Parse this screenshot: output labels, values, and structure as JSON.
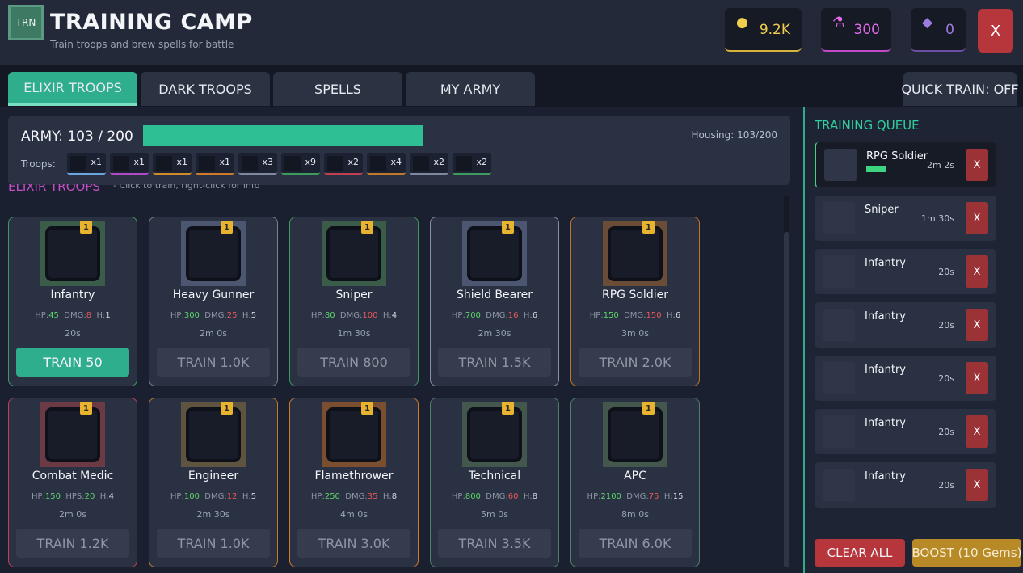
{
  "header": {
    "logo_text": "TRN",
    "title": "TRAINING CAMP",
    "subtitle": "Train troops and brew spells for battle",
    "resources": {
      "gold": "9.2K",
      "elixir": "300",
      "dark_elixir": "0"
    },
    "close_label": "X"
  },
  "tabs": [
    "ELIXIR TROOPS",
    "DARK TROOPS",
    "SPELLS",
    "MY ARMY"
  ],
  "active_tab": "ELIXIR TROOPS",
  "quick_train": "QUICK TRAIN: OFF",
  "army": {
    "label": "ARMY: 103 / 200",
    "fill_fraction": 0.515,
    "housing": "Housing: 103/200",
    "troops_label": "Troops:",
    "chips": [
      {
        "count": "x1",
        "color": "#6aa6e0"
      },
      {
        "count": "x1",
        "color": "#b04ac9"
      },
      {
        "count": "x1",
        "color": "#d08a2a"
      },
      {
        "count": "x1",
        "color": "#d07a2a"
      },
      {
        "count": "x3",
        "color": "#8088a0"
      },
      {
        "count": "x9",
        "color": "#3f9a60"
      },
      {
        "count": "x2",
        "color": "#c04050"
      },
      {
        "count": "x4",
        "color": "#c07a2a"
      },
      {
        "count": "x2",
        "color": "#8088a0"
      },
      {
        "count": "x2",
        "color": "#3f9a60"
      }
    ]
  },
  "section": {
    "title": "ELIXIR TROOPS",
    "hint": "- Click to train, right-click for info"
  },
  "cards": [
    {
      "name": "Infantry",
      "level": "1",
      "s1": "HP:",
      "v1": "45",
      "s2": "DMG:",
      "v2": "8",
      "s3": "H:",
      "v3": "1",
      "time": "20s",
      "train": "TRAIN  50",
      "border": "#3e9a5c",
      "portrait": "#3b5c48"
    },
    {
      "name": "Heavy Gunner",
      "level": "1",
      "s1": "HP:",
      "v1": "300",
      "s2": "DMG:",
      "v2": "25",
      "s3": "H:",
      "v3": "5",
      "time": "2m 0s",
      "train": "TRAIN  1.0K",
      "border": "#7a8090",
      "portrait": "#4d5670"
    },
    {
      "name": "Sniper",
      "level": "1",
      "s1": "HP:",
      "v1": "80",
      "s2": "DMG:",
      "v2": "100",
      "s3": "H:",
      "v3": "4",
      "time": "1m 30s",
      "train": "TRAIN  800",
      "border": "#3e9a5c",
      "portrait": "#3b5c48"
    },
    {
      "name": "Shield Bearer",
      "level": "1",
      "s1": "HP:",
      "v1": "700",
      "s2": "DMG:",
      "v2": "16",
      "s3": "H:",
      "v3": "6",
      "time": "2m 30s",
      "train": "TRAIN  1.5K",
      "border": "#8a90a8",
      "portrait": "#4d5670"
    },
    {
      "name": "RPG Soldier",
      "level": "1",
      "s1": "HP:",
      "v1": "150",
      "s2": "DMG:",
      "v2": "150",
      "s3": "H:",
      "v3": "6",
      "time": "3m 0s",
      "train": "TRAIN  2.0K",
      "border": "#c0742a",
      "portrait": "#6b4c36"
    },
    {
      "name": "Combat Medic",
      "level": "1",
      "s1": "HP:",
      "v1": "150",
      "s2": "HPS:",
      "v2": "20",
      "s3": "H:",
      "v3": "4",
      "time": "2m 0s",
      "train": "TRAIN  1.2K",
      "border": "#c04050",
      "portrait": "#6b3a44"
    },
    {
      "name": "Engineer",
      "level": "1",
      "s1": "HP:",
      "v1": "100",
      "s2": "DMG:",
      "v2": "12",
      "s3": "H:",
      "v3": "5",
      "time": "2m 30s",
      "train": "TRAIN  1.0K",
      "border": "#c07a2a",
      "portrait": "#5e5440"
    },
    {
      "name": "Flamethrower",
      "level": "1",
      "s1": "HP:",
      "v1": "250",
      "s2": "DMG:",
      "v2": "35",
      "s3": "H:",
      "v3": "8",
      "time": "4m 0s",
      "train": "TRAIN  3.0K",
      "border": "#d07a2a",
      "portrait": "#7a4e2e"
    },
    {
      "name": "Technical",
      "level": "1",
      "s1": "HP:",
      "v1": "800",
      "s2": "DMG:",
      "v2": "60",
      "s3": "H:",
      "v3": "8",
      "time": "5m 0s",
      "train": "TRAIN  3.5K",
      "border": "#4f7f64",
      "portrait": "#44574c"
    },
    {
      "name": "APC",
      "level": "1",
      "s1": "HP:",
      "v1": "2100",
      "s2": "DMG:",
      "v2": "75",
      "s3": "H:",
      "v3": "15",
      "time": "8m 0s",
      "train": "TRAIN  6.0K",
      "border": "#4f7f64",
      "portrait": "#44574c"
    }
  ],
  "queue": {
    "title": "TRAINING QUEUE",
    "items": [
      {
        "name": "RPG Soldier",
        "time": "2m 2s",
        "remove": "X"
      },
      {
        "name": "Sniper",
        "time": "1m 30s",
        "remove": "X"
      },
      {
        "name": "Infantry",
        "time": "20s",
        "remove": "X"
      },
      {
        "name": "Infantry",
        "time": "20s",
        "remove": "X"
      },
      {
        "name": "Infantry",
        "time": "20s",
        "remove": "X"
      },
      {
        "name": "Infantry",
        "time": "20s",
        "remove": "X"
      },
      {
        "name": "Infantry",
        "time": "20s",
        "remove": "X"
      }
    ],
    "clear_all": "CLEAR ALL",
    "boost": "BOOST (10 Gems)"
  }
}
